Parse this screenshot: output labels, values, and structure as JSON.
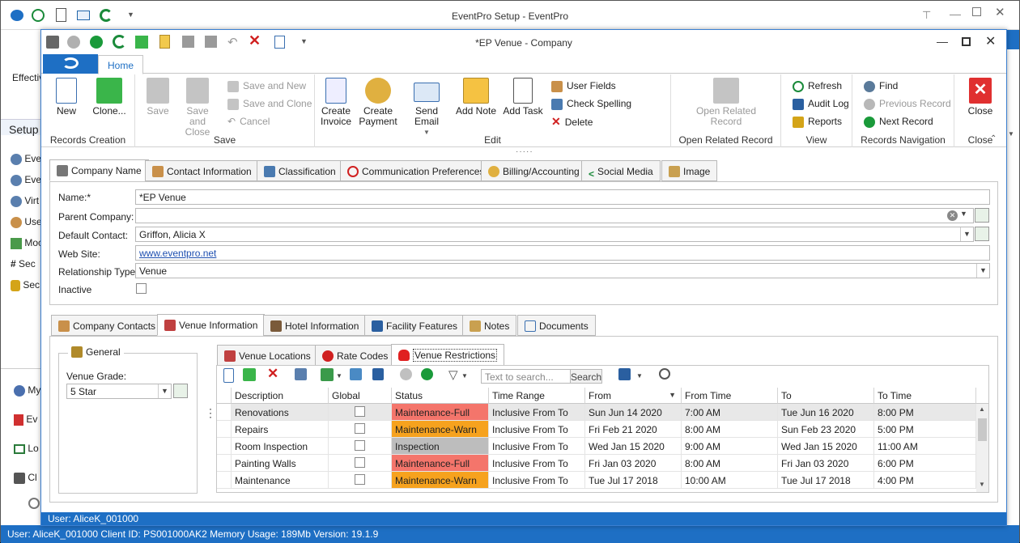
{
  "outer": {
    "title": "EventPro Setup - EventPro",
    "left_labels": [
      "Effectiv",
      "Setup",
      "Eve",
      "Eve",
      "Virt",
      "Use",
      "Moc",
      "Sec",
      "Sec",
      "My",
      "Ev",
      "Lo",
      "Cl"
    ],
    "status": "User: AliceK_001000    Client ID: PS001000AK2    Memory Usage: 189Mb    Version: 19.1.9"
  },
  "window": {
    "title": "*EP Venue - Company",
    "ribbon_tab": "Home",
    "status": "User: AliceK_001000"
  },
  "ribbon": {
    "groups": {
      "records_creation": "Records Creation",
      "save": "Save",
      "edit": "Edit",
      "open_related": "Open Related Record",
      "view": "View",
      "nav": "Records Navigation",
      "close": "Close"
    },
    "new": "New",
    "clone": "Clone...",
    "save": "Save",
    "save_close_1": "Save and",
    "save_close_2": "Close",
    "save_new": "Save and New",
    "save_clone": "Save and Clone",
    "cancel": "Cancel",
    "create_invoice_1": "Create",
    "create_invoice_2": "Invoice",
    "create_payment_1": "Create",
    "create_payment_2": "Payment",
    "send_email": "Send Email",
    "add_note": "Add Note",
    "add_task": "Add Task",
    "user_fields": "User Fields",
    "check_spelling": "Check Spelling",
    "delete": "Delete",
    "open_related_1": "Open Related",
    "open_related_2": "Record",
    "refresh": "Refresh",
    "audit_log": "Audit Log",
    "reports": "Reports",
    "find": "Find",
    "previous": "Previous Record",
    "next": "Next Record",
    "close": "Close"
  },
  "top_tabs": [
    "Company Name",
    "Contact Information",
    "Classification",
    "Communication Preferences",
    "Billing/Accounting",
    "Social Media",
    "Image"
  ],
  "form": {
    "name_label": "Name:*",
    "name_value": "*EP Venue",
    "parent_label": "Parent Company:",
    "parent_value": "",
    "contact_label": "Default Contact:",
    "contact_value": "Griffon, Alicia X",
    "web_label": "Web Site:",
    "web_value": "www.eventpro.net",
    "rel_label": "Relationship Type:",
    "rel_value": "Venue",
    "inactive_label": "Inactive"
  },
  "lower_tabs": [
    "Company Contacts",
    "Venue Information",
    "Hotel Information",
    "Facility Features",
    "Notes",
    "Documents"
  ],
  "general": {
    "title": "General",
    "grade_label": "Venue Grade:",
    "grade_value": "5 Star"
  },
  "sub_tabs": [
    "Venue Locations",
    "Rate Codes",
    "Venue Restrictions"
  ],
  "grid_toolbar": {
    "search_placeholder": "Text to search...",
    "search_button": "Search"
  },
  "grid": {
    "columns": [
      "Description",
      "Global",
      "Status",
      "Time Range",
      "From",
      "From Time",
      "To",
      "To Time"
    ],
    "rows": [
      {
        "description": "Renovations",
        "global": false,
        "status": "Maintenance-Full",
        "status_color": "#f4756b",
        "time_range": "Inclusive From To",
        "from": "Sun Jun 14 2020",
        "from_time": "7:00 AM",
        "to": "Tue Jun 16 2020",
        "to_time": "8:00 PM"
      },
      {
        "description": "Repairs",
        "global": false,
        "status": "Maintenance-Warn",
        "status_color": "#f6a21e",
        "time_range": "Inclusive From To",
        "from": "Fri Feb 21 2020",
        "from_time": "8:00 AM",
        "to": "Sun Feb 23 2020",
        "to_time": "5:00 PM"
      },
      {
        "description": "Room Inspection",
        "global": false,
        "status": "Inspection",
        "status_color": "#bdbdbd",
        "time_range": "Inclusive From To",
        "from": "Wed Jan 15 2020",
        "from_time": "9:00 AM",
        "to": "Wed Jan 15 2020",
        "to_time": "11:00 AM"
      },
      {
        "description": "Painting Walls",
        "global": false,
        "status": "Maintenance-Full",
        "status_color": "#f4756b",
        "time_range": "Inclusive From To",
        "from": "Fri Jan 03 2020",
        "from_time": "8:00 AM",
        "to": "Fri Jan 03 2020",
        "to_time": "6:00 PM"
      },
      {
        "description": "Maintenance",
        "global": false,
        "status": "Maintenance-Warn",
        "status_color": "#f6a21e",
        "time_range": "Inclusive From To",
        "from": "Tue Jul 17 2018",
        "from_time": "10:00 AM",
        "to": "Tue Jul 17 2018",
        "to_time": "4:00 PM"
      }
    ]
  }
}
